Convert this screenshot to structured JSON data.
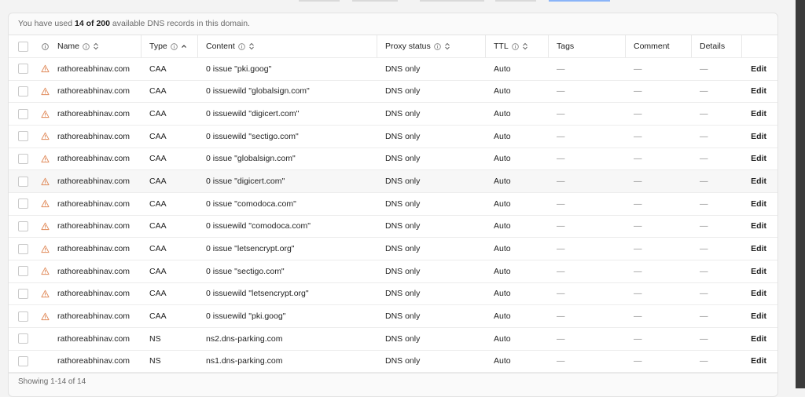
{
  "usage": {
    "prefix": "You have used ",
    "count": "14 of 200",
    "suffix": " available DNS records in this domain."
  },
  "columns": {
    "name": "Name",
    "type": "Type",
    "content": "Content",
    "proxy": "Proxy status",
    "ttl": "TTL",
    "tags": "Tags",
    "comment": "Comment",
    "details": "Details"
  },
  "records": [
    {
      "warn": true,
      "name": "rathoreabhinav.com",
      "type": "CAA",
      "content": "0 issue \"pki.goog\"",
      "proxy": "DNS only",
      "ttl": "Auto",
      "tags": "—",
      "comment": "—",
      "details": "—",
      "edit": "Edit"
    },
    {
      "warn": true,
      "name": "rathoreabhinav.com",
      "type": "CAA",
      "content": "0 issuewild \"globalsign.com\"",
      "proxy": "DNS only",
      "ttl": "Auto",
      "tags": "—",
      "comment": "—",
      "details": "—",
      "edit": "Edit"
    },
    {
      "warn": true,
      "name": "rathoreabhinav.com",
      "type": "CAA",
      "content": "0 issuewild \"digicert.com\"",
      "proxy": "DNS only",
      "ttl": "Auto",
      "tags": "—",
      "comment": "—",
      "details": "—",
      "edit": "Edit"
    },
    {
      "warn": true,
      "name": "rathoreabhinav.com",
      "type": "CAA",
      "content": "0 issuewild \"sectigo.com\"",
      "proxy": "DNS only",
      "ttl": "Auto",
      "tags": "—",
      "comment": "—",
      "details": "—",
      "edit": "Edit"
    },
    {
      "warn": true,
      "name": "rathoreabhinav.com",
      "type": "CAA",
      "content": "0 issue \"globalsign.com\"",
      "proxy": "DNS only",
      "ttl": "Auto",
      "tags": "—",
      "comment": "—",
      "details": "—",
      "edit": "Edit"
    },
    {
      "warn": true,
      "name": "rathoreabhinav.com",
      "type": "CAA",
      "content": "0 issue \"digicert.com\"",
      "proxy": "DNS only",
      "ttl": "Auto",
      "tags": "—",
      "comment": "—",
      "details": "—",
      "edit": "Edit"
    },
    {
      "warn": true,
      "name": "rathoreabhinav.com",
      "type": "CAA",
      "content": "0 issue \"comodoca.com\"",
      "proxy": "DNS only",
      "ttl": "Auto",
      "tags": "—",
      "comment": "—",
      "details": "—",
      "edit": "Edit"
    },
    {
      "warn": true,
      "name": "rathoreabhinav.com",
      "type": "CAA",
      "content": "0 issuewild \"comodoca.com\"",
      "proxy": "DNS only",
      "ttl": "Auto",
      "tags": "—",
      "comment": "—",
      "details": "—",
      "edit": "Edit"
    },
    {
      "warn": true,
      "name": "rathoreabhinav.com",
      "type": "CAA",
      "content": "0 issue \"letsencrypt.org\"",
      "proxy": "DNS only",
      "ttl": "Auto",
      "tags": "—",
      "comment": "—",
      "details": "—",
      "edit": "Edit"
    },
    {
      "warn": true,
      "name": "rathoreabhinav.com",
      "type": "CAA",
      "content": "0 issue \"sectigo.com\"",
      "proxy": "DNS only",
      "ttl": "Auto",
      "tags": "—",
      "comment": "—",
      "details": "—",
      "edit": "Edit"
    },
    {
      "warn": true,
      "name": "rathoreabhinav.com",
      "type": "CAA",
      "content": "0 issuewild \"letsencrypt.org\"",
      "proxy": "DNS only",
      "ttl": "Auto",
      "tags": "—",
      "comment": "—",
      "details": "—",
      "edit": "Edit"
    },
    {
      "warn": true,
      "name": "rathoreabhinav.com",
      "type": "CAA",
      "content": "0 issuewild \"pki.goog\"",
      "proxy": "DNS only",
      "ttl": "Auto",
      "tags": "—",
      "comment": "—",
      "details": "—",
      "edit": "Edit"
    },
    {
      "warn": false,
      "name": "rathoreabhinav.com",
      "type": "NS",
      "content": "ns2.dns-parking.com",
      "proxy": "DNS only",
      "ttl": "Auto",
      "tags": "—",
      "comment": "—",
      "details": "—",
      "edit": "Edit"
    },
    {
      "warn": false,
      "name": "rathoreabhinav.com",
      "type": "NS",
      "content": "ns1.dns-parking.com",
      "proxy": "DNS only",
      "ttl": "Auto",
      "tags": "—",
      "comment": "—",
      "details": "—",
      "edit": "Edit"
    }
  ],
  "footer": {
    "showing": "Showing 1-14 of 14"
  },
  "colors": {
    "warning": "#e08a5a",
    "accent": "#8ab4f8"
  },
  "icons": {
    "warning": "warning-triangle-icon",
    "info": "info-circle-icon",
    "sort": "sort-arrows-icon",
    "sort_asc": "sort-ascending-icon"
  }
}
